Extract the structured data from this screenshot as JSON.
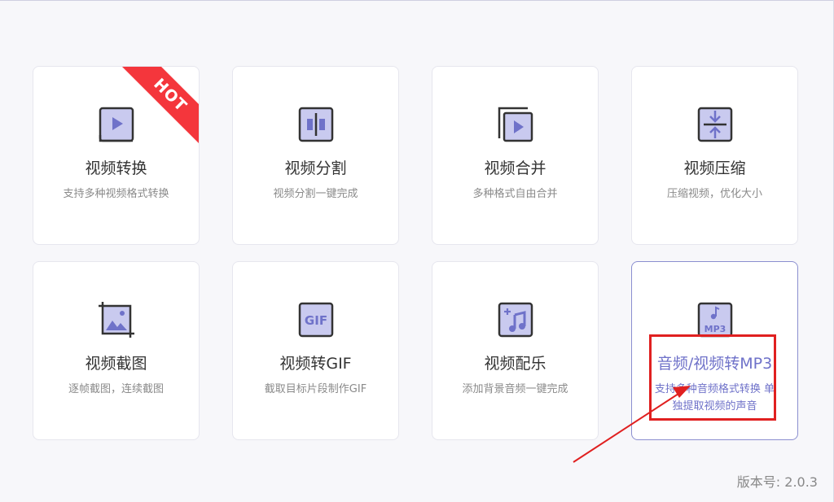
{
  "tools": [
    {
      "title": "视频转换",
      "desc": "支持多种视频格式转换",
      "badge": "HOT",
      "icon": "video-convert-icon"
    },
    {
      "title": "视频分割",
      "desc": "视频分割一键完成",
      "icon": "video-split-icon"
    },
    {
      "title": "视频合并",
      "desc": "多种格式自由合并",
      "icon": "video-merge-icon"
    },
    {
      "title": "视频压缩",
      "desc": "压缩视频，优化大小",
      "icon": "video-compress-icon"
    },
    {
      "title": "视频截图",
      "desc": "逐帧截图，连续截图",
      "icon": "video-screenshot-icon"
    },
    {
      "title": "视频转GIF",
      "desc": "截取目标片段制作GIF",
      "icon_text": "GIF",
      "icon": "gif-icon"
    },
    {
      "title": "视频配乐",
      "desc": "添加背景音频一键完成",
      "icon": "add-music-icon"
    },
    {
      "title": "音频/视频转MP3",
      "desc": "支持多种音频格式转换 单独提取视频的声音",
      "icon_text": "MP3",
      "icon": "mp3-icon"
    }
  ],
  "version": "版本号: 2.0.3",
  "colors": {
    "accent": "#6f72c9",
    "icon_fill": "#c9caef",
    "icon_stroke": "#333333",
    "hot": "#f4363c",
    "annotation": "#e02020"
  }
}
